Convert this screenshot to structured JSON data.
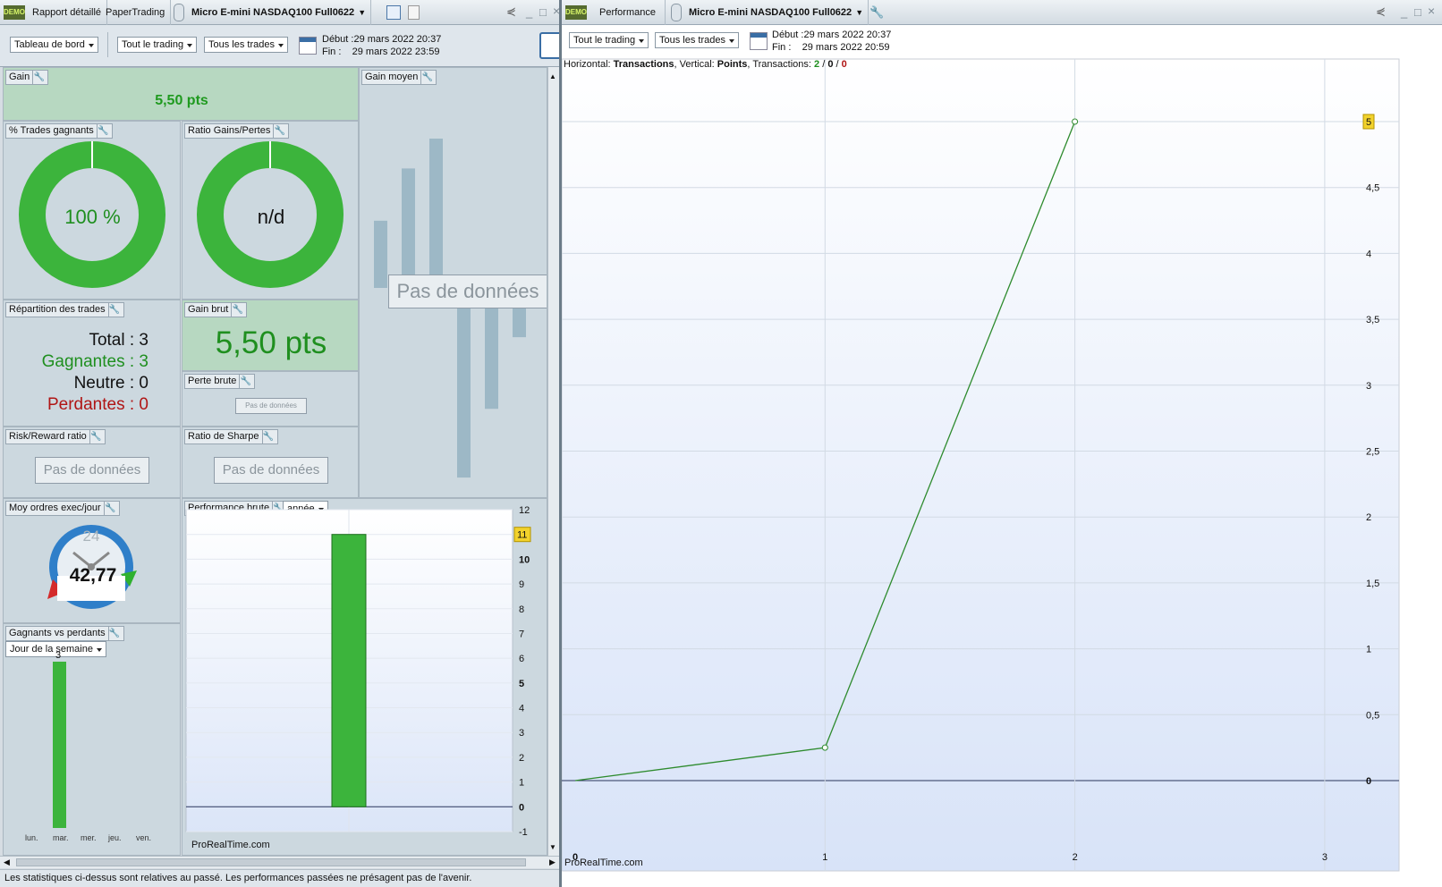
{
  "left_window": {
    "tabs": {
      "rapport": "Rapport détaillé",
      "paper": "PaperTrading",
      "instrument": "Micro E-mini NASDAQ100 Full0622"
    },
    "logo": "DEMO",
    "toolbar": {
      "dashboard": "Tableau de bord",
      "trading": "Tout le trading",
      "trades": "Tous les trades",
      "debut": "Début :29 mars 2022 20:37",
      "fin": "Fin :    29 mars 2022 23:59"
    },
    "gain": {
      "title": "Gain",
      "value": "5,50 pts"
    },
    "pct_trades": {
      "title": "% Trades gagnants",
      "value": "100 %"
    },
    "ratio": {
      "title": "Ratio Gains/Pertes",
      "value": "n/d"
    },
    "gain_moyen": {
      "title": "Gain moyen",
      "nodata": "Pas de données",
      "bars": [
        -0.45,
        -0.8,
        -1.0,
        1.27,
        0.81,
        0.33
      ]
    },
    "repartition": {
      "title": "Répartition des trades",
      "total": "Total : 3",
      "gagnantes": "Gagnantes : 3",
      "neutre": "Neutre : 0",
      "perdantes": "Perdantes : 0"
    },
    "gain_brut": {
      "title": "Gain brut",
      "value": "5,50 pts"
    },
    "perte_brute": {
      "title": "Perte brute",
      "nodata": "Pas de données"
    },
    "risk": {
      "title": "Risk/Reward ratio",
      "nodata": "Pas de données"
    },
    "sharpe": {
      "title": "Ratio de Sharpe",
      "nodata": "Pas de données"
    },
    "moy_ordres": {
      "title": "Moy ordres exec/jour",
      "gauge_max": "24",
      "value": "42,77"
    },
    "perf_brute": {
      "title": "Performance brute",
      "period": "année",
      "watermark": "ProRealTime.com"
    },
    "gagnants": {
      "title": "Gagnants vs perdants",
      "period": "Jour de la semaine",
      "bar_label": "3",
      "days": [
        "lun.",
        "mar.",
        "mer.",
        "jeu.",
        "ven."
      ]
    },
    "footer": "Les statistiques ci-dessus sont relatives au passé. Les performances passées ne présagent pas de l'avenir."
  },
  "right_window": {
    "tabs": {
      "perf": "Performance",
      "instrument": "Micro E-mini NASDAQ100 Full0622"
    },
    "toolbar": {
      "trading": "Tout le trading",
      "trades": "Tous les trades",
      "debut": "Début :29 mars 2022 20:37",
      "fin": "Fin :    29 mars 2022 20:59"
    },
    "info": {
      "horiz_label": "Horizontal: ",
      "horiz": "Transactions",
      "vert_label": ", Vertical: ",
      "vert": "Points",
      "trans_label": ", Transactions: ",
      "t_win": "2",
      "t_sep1": " / ",
      "t_neutral": "0",
      "t_sep2": " / ",
      "t_lose": "0"
    },
    "watermark": "ProRealTime.com"
  },
  "chart_data": [
    {
      "type": "bar",
      "title": "Performance brute",
      "categories": [
        ""
      ],
      "values": [
        11
      ],
      "ylim": [
        -1,
        12
      ],
      "yticks": [
        "12",
        "11",
        "10",
        "9",
        "8",
        "7",
        "6",
        "5",
        "4",
        "3",
        "2",
        "1",
        "0",
        "-1"
      ],
      "current_value": "11",
      "bar_color": "#3cb43c"
    },
    {
      "type": "line",
      "title": "Performance",
      "x": [
        0,
        1,
        2
      ],
      "y": [
        0,
        0.25,
        5
      ],
      "xlim": [
        0,
        3
      ],
      "ylim": [
        -0.5,
        5.5
      ],
      "xticks": [
        "0",
        "1",
        "2",
        "3"
      ],
      "yticks": [
        "5",
        "4,5",
        "4",
        "3,5",
        "3",
        "2,5",
        "2",
        "1,5",
        "1",
        "0,5",
        "0"
      ],
      "current_value": "5",
      "line_color": "#2e8b2e"
    },
    {
      "type": "bar",
      "title": "Gagnants vs perdants",
      "categories": [
        "lun.",
        "mar.",
        "mer.",
        "jeu.",
        "ven."
      ],
      "values": [
        3,
        0,
        0,
        0,
        0
      ],
      "bar_color": "#3cb43c"
    }
  ]
}
